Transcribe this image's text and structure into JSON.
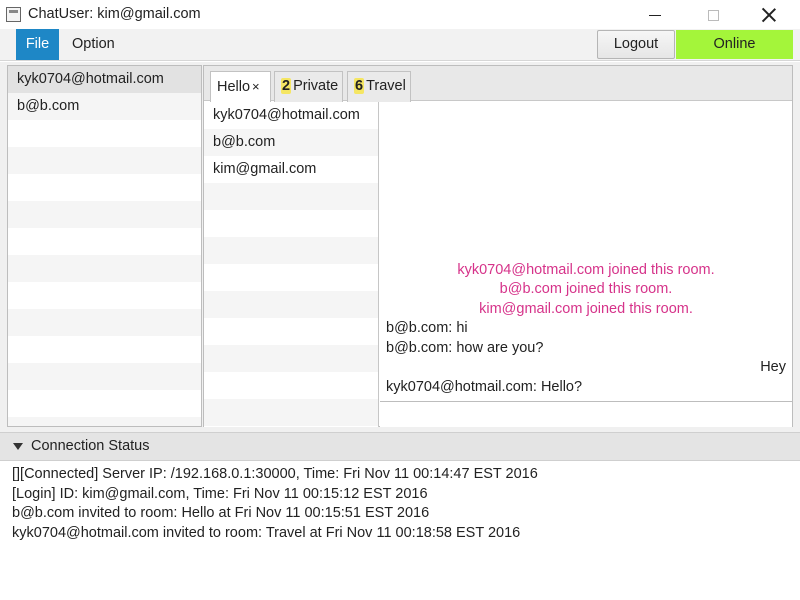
{
  "window": {
    "title": "ChatUser: kim@gmail.com"
  },
  "menubar": {
    "file": "File",
    "option": "Option",
    "logout": "Logout",
    "online": "Online"
  },
  "colors": {
    "menu_active": "#1e87c6",
    "online": "#a4f53a",
    "system_message": "#d6338a",
    "badge": "#f5e663"
  },
  "users": [
    {
      "label": "kyk0704@hotmail.com",
      "selected": true
    },
    {
      "label": "b@b.com",
      "selected": false
    }
  ],
  "tabs": [
    {
      "label": "Hello",
      "close": "×",
      "active": true
    },
    {
      "badge": "2",
      "label": "Private",
      "active": false
    },
    {
      "badge": "6",
      "label": "Travel",
      "active": false
    }
  ],
  "room_members": [
    "kyk0704@hotmail.com",
    "b@b.com",
    "kim@gmail.com"
  ],
  "messages": [
    {
      "type": "system",
      "text": "kyk0704@hotmail.com joined this room."
    },
    {
      "type": "system",
      "text": "b@b.com joined this room."
    },
    {
      "type": "system",
      "text": "kim@gmail.com joined this room."
    },
    {
      "type": "left",
      "text": "b@b.com: hi"
    },
    {
      "type": "left",
      "text": "b@b.com: how are you?"
    },
    {
      "type": "right",
      "text": "Hey"
    },
    {
      "type": "left",
      "text": "kyk0704@hotmail.com: Hello?"
    }
  ],
  "chat_input": {
    "value": ""
  },
  "connection_status": {
    "title": "Connection Status",
    "log": [
      "[][Connected] Server IP: /192.168.0.1:30000, Time: Fri Nov 11 00:14:47 EST 2016",
      "[Login] ID: kim@gmail.com, Time: Fri Nov 11 00:15:12 EST 2016",
      "b@b.com invited to room: Hello at Fri Nov 11 00:15:51 EST 2016",
      "kyk0704@hotmail.com invited to room: Travel at Fri Nov 11 00:18:58 EST 2016"
    ]
  }
}
